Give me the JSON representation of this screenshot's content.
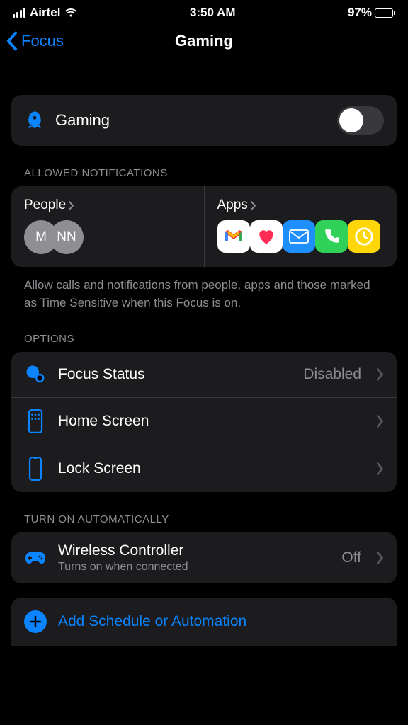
{
  "status": {
    "carrier": "Airtel",
    "time": "3:50 AM",
    "battery_pct": "97%"
  },
  "nav": {
    "back_label": "Focus",
    "title": "Gaming"
  },
  "gaming": {
    "label": "Gaming",
    "enabled": false
  },
  "allowed": {
    "header": "Allowed Notifications",
    "people_label": "People",
    "apps_label": "Apps",
    "avatars": [
      "M",
      "NN"
    ],
    "footnote": "Allow calls and notifications from people, apps and those marked as Time Sensitive when this Focus is on."
  },
  "options": {
    "header": "Options",
    "focus_status": {
      "label": "Focus Status",
      "value": "Disabled"
    },
    "home_screen": {
      "label": "Home Screen"
    },
    "lock_screen": {
      "label": "Lock Screen"
    }
  },
  "auto": {
    "header": "Turn On Automatically",
    "wireless": {
      "label": "Wireless Controller",
      "sub": "Turns on when connected",
      "value": "Off"
    },
    "add_label": "Add Schedule or Automation"
  }
}
